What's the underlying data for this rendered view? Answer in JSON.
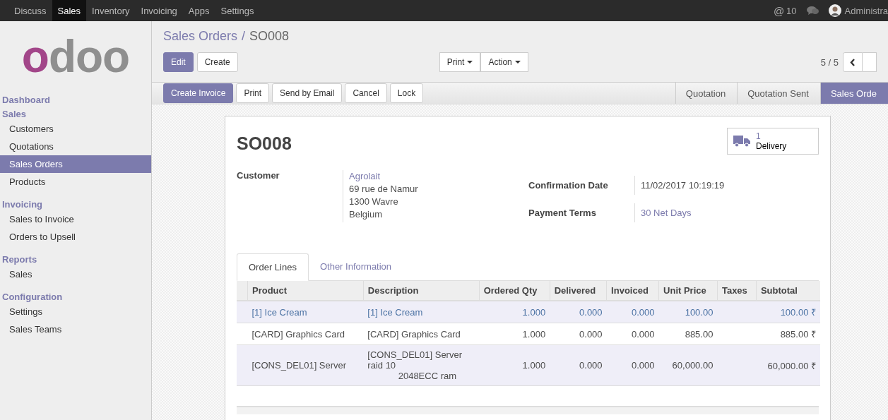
{
  "top_menu": [
    {
      "label": "Discuss",
      "selected": false
    },
    {
      "label": "Sales",
      "selected": true
    },
    {
      "label": "Inventory",
      "selected": false
    },
    {
      "label": "Invoicing",
      "selected": false
    },
    {
      "label": "Apps",
      "selected": false
    },
    {
      "label": "Settings",
      "selected": false
    }
  ],
  "systray": {
    "mention_symbol": "@",
    "mention_count": "10",
    "user": "Administra"
  },
  "logo": "odoo",
  "sidebar": {
    "sections": [
      {
        "title": "Dashboard"
      },
      {
        "title": "Sales",
        "items": [
          {
            "label": "Customers",
            "selected": false
          },
          {
            "label": "Quotations",
            "selected": false
          },
          {
            "label": "Sales Orders",
            "selected": true
          },
          {
            "label": "Products",
            "selected": false
          }
        ]
      },
      {
        "title": "Invoicing",
        "items": [
          {
            "label": "Sales to Invoice",
            "selected": false
          },
          {
            "label": "Orders to Upsell",
            "selected": false
          }
        ]
      },
      {
        "title": "Reports",
        "items": [
          {
            "label": "Sales",
            "selected": false
          }
        ]
      },
      {
        "title": "Configuration",
        "items": [
          {
            "label": "Settings",
            "selected": false
          },
          {
            "label": "Sales Teams",
            "selected": false
          }
        ]
      }
    ]
  },
  "breadcrumb": {
    "items": [
      "Sales Orders",
      "SO008"
    ],
    "separator": "/"
  },
  "buttons": [
    {
      "label": "Edit",
      "kind": "primary"
    },
    {
      "label": "Create",
      "kind": "default"
    }
  ],
  "dropdowns": [
    "Print",
    "Action"
  ],
  "pager": {
    "value": "5 / 5"
  },
  "header_buttons": [
    {
      "label": "Create Invoice",
      "kind": "primary"
    },
    {
      "label": "Print",
      "kind": "default"
    },
    {
      "label": "Send by Email",
      "kind": "default"
    },
    {
      "label": "Cancel",
      "kind": "default"
    },
    {
      "label": "Lock",
      "kind": "default"
    }
  ],
  "stages": [
    {
      "label": "Quotation",
      "selected": false
    },
    {
      "label": "Quotation Sent",
      "selected": false
    },
    {
      "label": "Sales Orde",
      "selected": true
    }
  ],
  "sheet": {
    "title": "SO008",
    "smart_button": {
      "count": "1",
      "label": "Delivery"
    },
    "customer": {
      "label": "Customer",
      "name": "Agrolait",
      "address": [
        "69 rue de Namur",
        "1300 Wavre",
        "Belgium"
      ]
    },
    "fields": [
      {
        "label": "Confirmation Date",
        "value": "11/02/2017 10:19:19",
        "kind": "text"
      },
      {
        "label": "Payment Terms",
        "value": "30 Net Days",
        "kind": "link"
      }
    ],
    "tabs": [
      {
        "label": "Order Lines",
        "selected": true
      },
      {
        "label": "Other Information",
        "selected": false
      }
    ],
    "table": {
      "columns": [
        "Product",
        "Description",
        "Ordered Qty",
        "Delivered",
        "Invoiced",
        "Unit Price",
        "Taxes",
        "Subtotal"
      ],
      "rows": [
        {
          "highlighted": true,
          "cells": [
            "[1] Ice Cream",
            "[1] Ice Cream",
            "1.000",
            "0.000",
            "0.000",
            "100.00",
            "",
            "100.00 ₹"
          ]
        },
        {
          "highlighted": false,
          "cells": [
            "[CARD] Graphics Card",
            "[CARD] Graphics Card",
            "1.000",
            "0.000",
            "0.000",
            "885.00",
            "",
            "885.00 ₹"
          ]
        },
        {
          "highlighted": false,
          "cells": [
            "[CONS_DEL01] Server",
            "[CONS_DEL01] Server\nraid 10\n            2048ECC ram",
            "1.000",
            "0.000",
            "0.000",
            "60,000.00",
            "",
            "60,000.00 ₹"
          ]
        }
      ]
    }
  }
}
